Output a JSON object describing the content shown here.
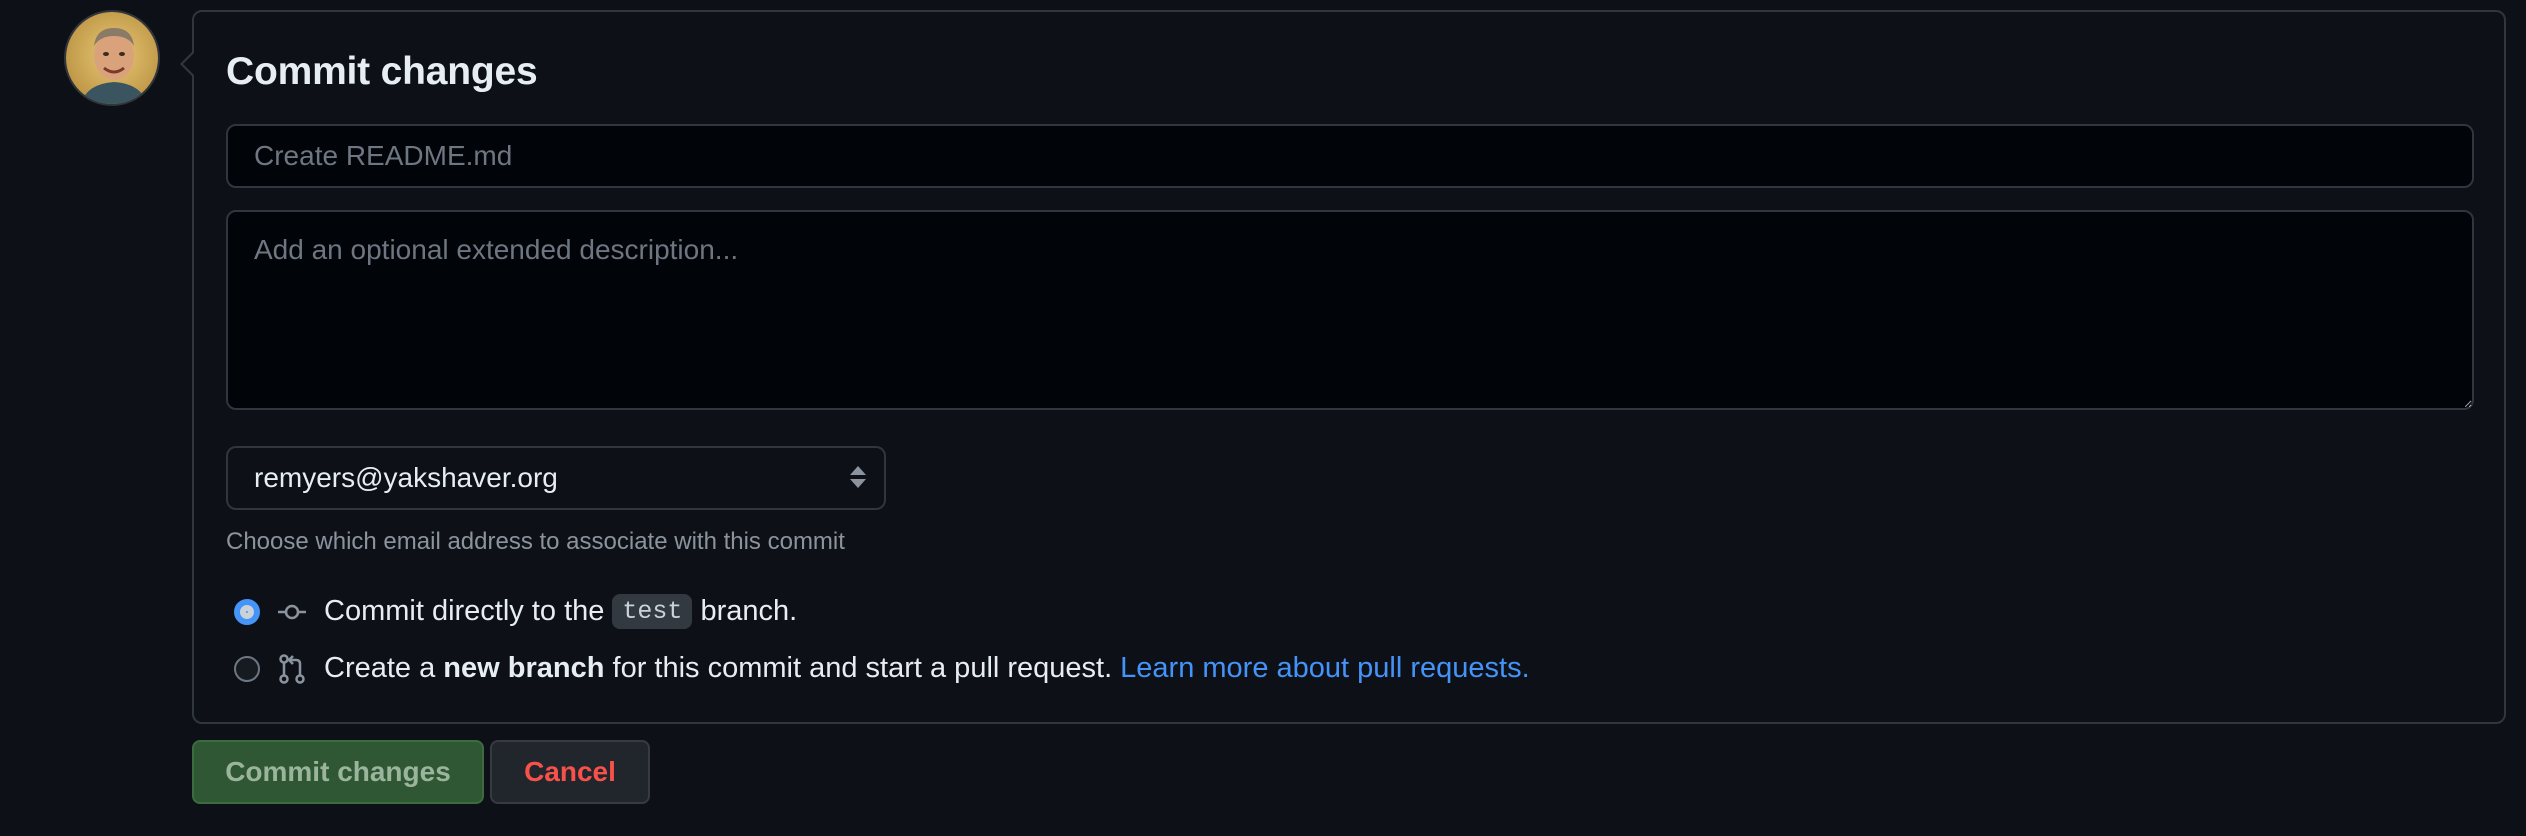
{
  "form": {
    "title": "Commit changes",
    "summary_placeholder": "Create README.md",
    "summary_value": "",
    "description_placeholder": "Add an optional extended description...",
    "description_value": "",
    "email_selected": "remyers@yakshaver.org",
    "email_hint": "Choose which email address to associate with this commit"
  },
  "options": {
    "direct": {
      "prefix": "Commit directly to the",
      "branch": "test",
      "suffix": "branch.",
      "checked": true,
      "icon": "git-commit-icon"
    },
    "new_branch": {
      "prefix": "Create a",
      "bold": "new branch",
      "suffix": "for this commit and start a pull request.",
      "link": "Learn more about pull requests.",
      "checked": false,
      "icon": "git-pull-request-icon"
    }
  },
  "buttons": {
    "commit_label": "Commit changes",
    "cancel_label": "Cancel"
  },
  "colors": {
    "accent": "#4493f8",
    "commit_button": "#2f5733",
    "danger": "#f85149"
  }
}
